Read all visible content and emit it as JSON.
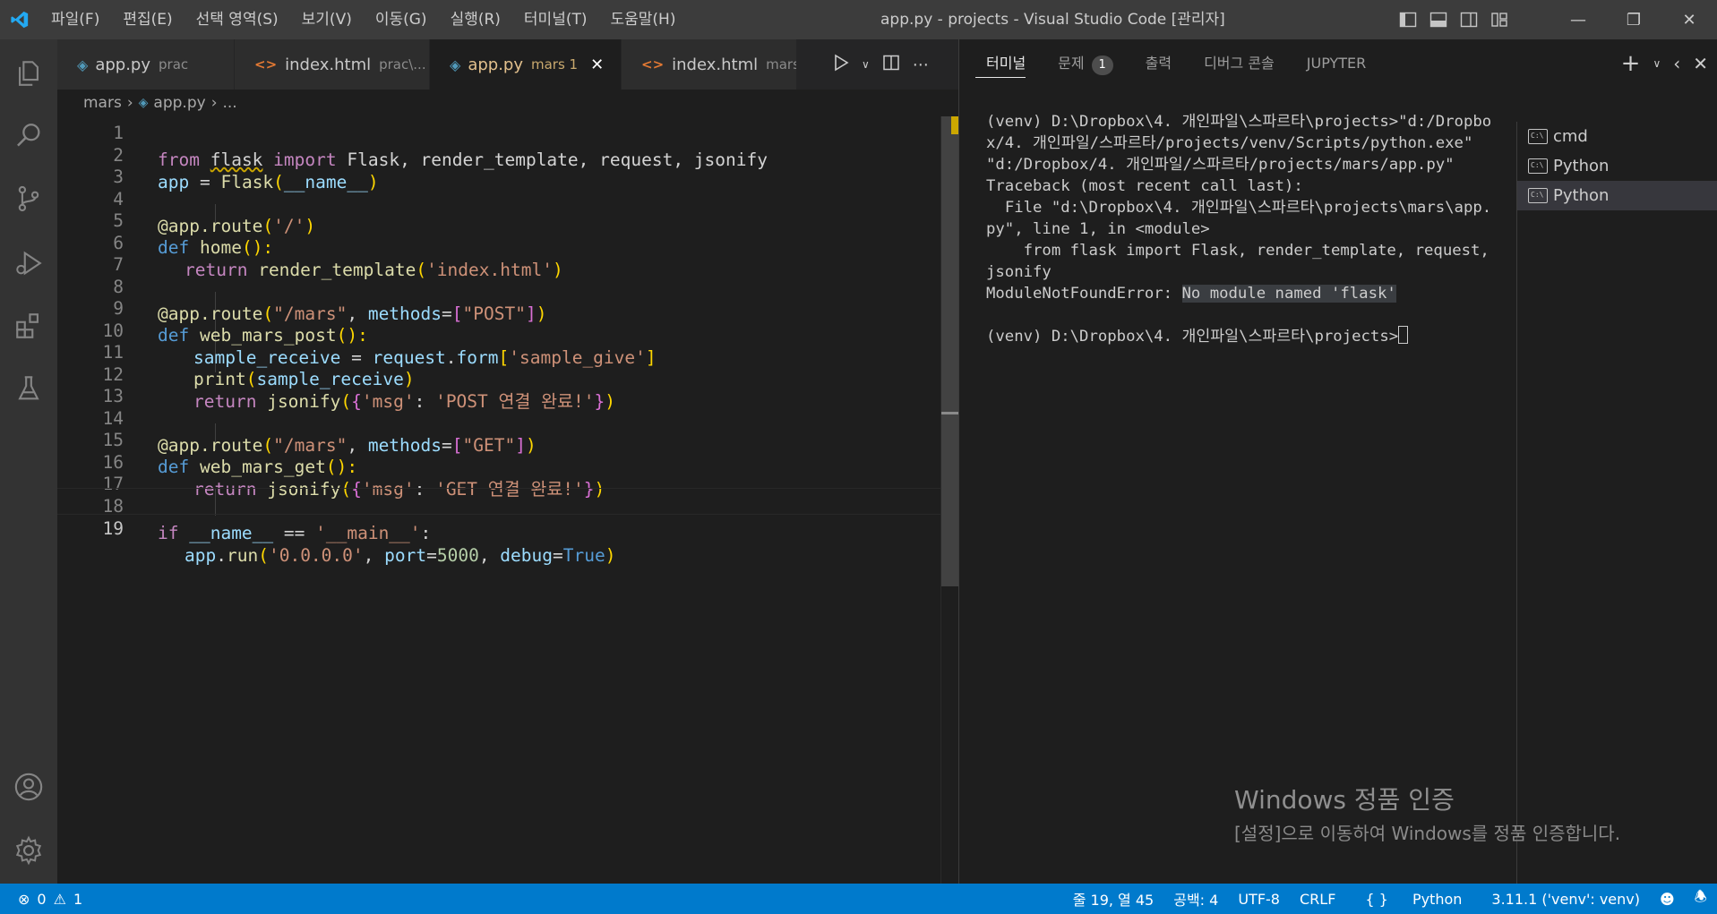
{
  "titlebar": {
    "menus": [
      "파일(F)",
      "편집(E)",
      "선택 영역(S)",
      "보기(V)",
      "이동(G)",
      "실행(R)",
      "터미널(T)",
      "도움말(H)"
    ],
    "window_title": "app.py - projects - Visual Studio Code [관리자]"
  },
  "tabs": [
    {
      "name": "app.py",
      "desc": "prac",
      "type": "py"
    },
    {
      "name": "index.html",
      "desc": "prac\\...",
      "type": "html"
    },
    {
      "name": "app.py",
      "desc": "mars 1",
      "type": "py",
      "active": true
    },
    {
      "name": "index.html",
      "desc": "mars\\...",
      "type": "html"
    }
  ],
  "breadcrumb": {
    "folder": "mars",
    "file": "app.py",
    "more": "..."
  },
  "editor": {
    "lines": [
      "1",
      "2",
      "3",
      "4",
      "5",
      "6",
      "7",
      "8",
      "9",
      "10",
      "11",
      "12",
      "13",
      "14",
      "15",
      "16",
      "17",
      "18",
      "19"
    ],
    "code_text": {
      "l1": [
        "from",
        "flask",
        "import",
        "Flask, render_template, request, jsonify"
      ],
      "l2": [
        "app",
        " = ",
        "Flask",
        "(",
        "__name__",
        ")"
      ],
      "l4": [
        "@app.route",
        "(",
        "'/'",
        ")"
      ],
      "l5": [
        "def",
        "home",
        "():"
      ],
      "l6": [
        "return",
        "render_template",
        "(",
        "'index.html'",
        ")"
      ],
      "l8": [
        "@app.route",
        "(",
        "\"/mars\"",
        ", ",
        "methods",
        "=",
        "[",
        "\"POST\"",
        "]",
        ")"
      ],
      "l9": [
        "def",
        "web_mars_post",
        "():"
      ],
      "l10": [
        "sample_receive",
        " = ",
        "request",
        ".",
        "form",
        "[",
        "'sample_give'",
        "]"
      ],
      "l11": [
        "print",
        "(",
        "sample_receive",
        ")"
      ],
      "l12": [
        "return",
        "jsonify",
        "(",
        "{",
        "'msg'",
        ": ",
        "'POST 연결 완료!'",
        "}",
        ")"
      ],
      "l14": [
        "@app.route",
        "(",
        "\"/mars\"",
        ", ",
        "methods",
        "=",
        "[",
        "\"GET\"",
        "]",
        ")"
      ],
      "l15": [
        "def",
        "web_mars_get",
        "():"
      ],
      "l16": [
        "return",
        "jsonify",
        "(",
        "{",
        "'msg'",
        ": ",
        "'GET 연결 완료!'",
        "}",
        ")"
      ],
      "l18": [
        "if",
        "__name__",
        " == ",
        "'__main__'",
        ":"
      ],
      "l19": [
        "app",
        ".",
        "run",
        "(",
        "'0.0.0.0'",
        ", ",
        "port",
        "=",
        "5000",
        ", ",
        "debug",
        "=",
        "True",
        ")"
      ]
    }
  },
  "panel": {
    "tabs": [
      "터미널",
      "문제",
      "출력",
      "디버그 콘솔",
      "JUPYTER"
    ],
    "problems_count": "1",
    "terminal_lines": [
      "(venv) D:\\Dropbox\\4. 개인파일\\스파르타\\projects>\"d:/Dropbox/4. 개인파일/스파르타/projects/venv/Scripts/python.exe\" \"d:/Dropbox/4. 개인파일/스파르타/projects/mars/app.py\"",
      "Traceback (most recent call last):",
      "  File \"d:\\Dropbox\\4. 개인파일\\스파르타\\projects\\mars\\app.py\", line 1, in <module>",
      "    from flask import Flask, render_template, request, jsonify",
      "ModuleNotFoundError: ",
      "No module named 'flask'",
      "",
      "(venv) D:\\Dropbox\\4. 개인파일\\스파르타\\projects>"
    ],
    "terminal_instances": [
      "cmd",
      "Python",
      "Python"
    ]
  },
  "watermark": {
    "title": "Windows 정품 인증",
    "body": "[설정]으로 이동하여 Windows를 정품 인증합니다."
  },
  "statusbar": {
    "errors": "0",
    "warnings": "1",
    "position": "줄 19, 열 45",
    "spaces": "공백: 4",
    "encoding": "UTF-8",
    "eol": "CRLF",
    "language": "Python",
    "interpreter": "3.11.1 ('venv': venv)"
  },
  "colors": {
    "statusbar": "#007acc",
    "titlebar": "#3c3c3c",
    "activitybar": "#333333",
    "editor_bg": "#1e1e1e"
  }
}
